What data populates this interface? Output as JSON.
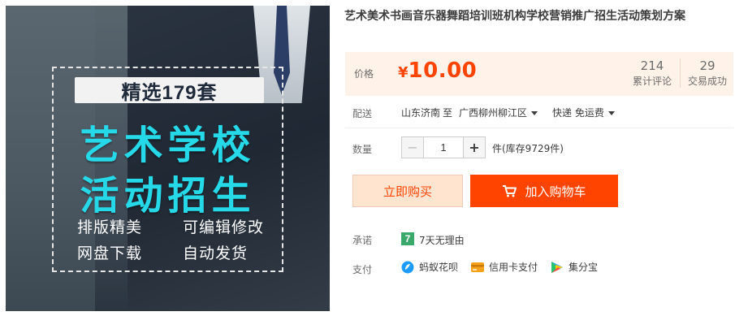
{
  "product_image": {
    "badge": "精选179套",
    "headline_line1": "艺术学校",
    "headline_line2": "活动招生",
    "features": [
      "排版精美",
      "可编辑修改",
      "网盘下载",
      "自动发货"
    ]
  },
  "product": {
    "title": "艺术美术书画音乐器舞蹈培训班机构学校营销推广招生活动策划方案"
  },
  "price_section": {
    "label": "价格",
    "currency": "¥",
    "price": "10.00",
    "reviews_count": "214",
    "reviews_label": "累计评论",
    "transactions_count": "29",
    "transactions_label": "交易成功",
    "price_color": "#ff4400",
    "background_color": "#fff2e8"
  },
  "shipping": {
    "label": "配送",
    "from": "山东济南",
    "to_word": "至",
    "destination": "广西柳州柳江区",
    "method": "快递 免运费"
  },
  "quantity": {
    "label": "数量",
    "minus": "−",
    "value": "1",
    "plus": "+",
    "stock_text": "件(库存9729件)"
  },
  "actions": {
    "buy_now": "立即购买",
    "add_to_cart": "加入购物车",
    "cart_icon": "shopping-cart-icon",
    "accent_color": "#ff4400"
  },
  "promise": {
    "label": "承诺",
    "icon_glyph": "7",
    "text": "7天无理由"
  },
  "payment": {
    "label": "支付",
    "methods": [
      {
        "name": "蚂蚁花呗",
        "icon": "huabei-icon"
      },
      {
        "name": "信用卡支付",
        "icon": "credit-card-icon"
      },
      {
        "name": "集分宝",
        "icon": "jifenbao-icon"
      }
    ]
  }
}
